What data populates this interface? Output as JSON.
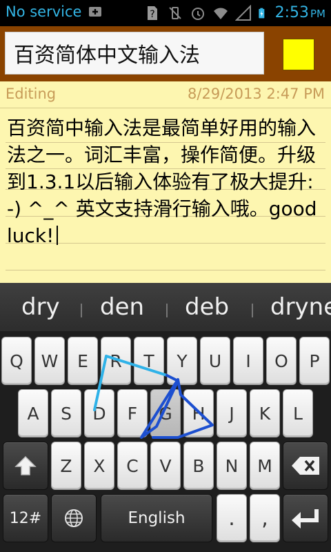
{
  "status": {
    "carrier": "No service",
    "time": "2:53",
    "ampm": "PM"
  },
  "title_field": {
    "value": "百资简体中文输入法"
  },
  "note": {
    "status_label": "Editing",
    "timestamp": "8/29/2013 2:47 PM",
    "body": "百资简中输入法是最简单好用的输入法之一。词汇丰富，操作简便。升级到1.3.1以后输入体验有了极大提升:-) ^_^ 英文支持滑行输入哦。good luck!"
  },
  "suggestions": [
    "dry",
    "den",
    "deb",
    "dryne"
  ],
  "keyboard": {
    "row1": [
      "Q",
      "W",
      "E",
      "R",
      "T",
      "Y",
      "U",
      "I",
      "O",
      "P"
    ],
    "row2": [
      "A",
      "S",
      "D",
      "F",
      "G",
      "H",
      "J",
      "K",
      "L"
    ],
    "row3": [
      "Z",
      "X",
      "C",
      "V",
      "B",
      "N",
      "M"
    ],
    "mode_key": "12#",
    "language_key": "English",
    "period_key": ".",
    "comma_key": ","
  },
  "colors": {
    "accent": "#33b5e5",
    "titlebar": "#8a4300",
    "swatch": "#ffff00",
    "note_bg": "#fdf6b0",
    "swipe_light": "#2fb2e8",
    "swipe_dark": "#1c4fd0"
  },
  "icons": {
    "status": [
      "keyboard-notification-icon",
      "sim-unknown-icon",
      "vibrate-icon",
      "alarm-icon",
      "wifi-icon",
      "signal-icon",
      "battery-charging-icon"
    ],
    "keyboard": [
      "shift-icon",
      "backspace-icon",
      "globe-icon",
      "enter-icon"
    ]
  }
}
